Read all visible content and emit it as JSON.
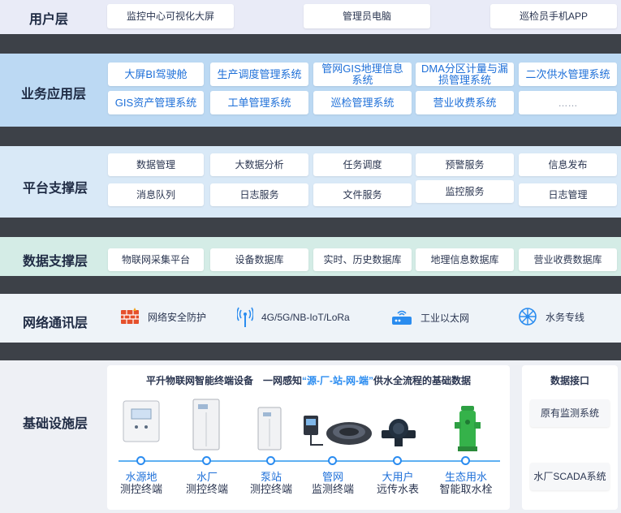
{
  "layers": {
    "user": {
      "title": "用户层",
      "items": [
        "监控中心可视化大屏",
        "管理员电脑",
        "巡检员手机APP"
      ]
    },
    "business": {
      "title": "业务应用层",
      "row1": [
        "大屏BI驾驶舱",
        "生产调度管理系统",
        "管网GIS地理信息系统",
        "DMA分区计量与漏损管理系统",
        "二次供水管理系统"
      ],
      "row2": [
        "GIS资产管理系统",
        "工单管理系统",
        "巡检管理系统",
        "营业收费系统",
        "……"
      ]
    },
    "platform": {
      "title": "平台支撑层",
      "row1": [
        "数据管理",
        "大数据分析",
        "任务调度",
        "预警服务",
        "信息发布"
      ],
      "row2": [
        "消息队列",
        "日志服务",
        "文件服务",
        "监控服务",
        "日志管理"
      ]
    },
    "data": {
      "title": "数据支撑层",
      "items": [
        "物联网采集平台",
        "设备数据库",
        "实时、历史数据库",
        "地理信息数据库",
        "营业收费数据库"
      ]
    },
    "network": {
      "title": "网络通讯层",
      "items": [
        {
          "label": "网络安全防护",
          "icon": "firewall-icon"
        },
        {
          "label": "4G/5G/NB-IoT/LoRa",
          "icon": "antenna-icon"
        },
        {
          "label": "工业以太网",
          "icon": "router-icon"
        },
        {
          "label": "水务专线",
          "icon": "network-node-icon"
        }
      ]
    },
    "infra": {
      "title": "基础设施层",
      "headline_prefix": "平升物联网智能终端设备　一网感知",
      "headline_highlight": "“源-厂-站-网-端”",
      "headline_suffix": "供水全流程的基础数据",
      "devices": [
        {
          "line1": "水源地",
          "line2": "测控终端"
        },
        {
          "line1": "水厂",
          "line2": "测控终端"
        },
        {
          "line1": "泵站",
          "line2": "测控终端"
        },
        {
          "line1": "管网",
          "line2": "监测终端"
        },
        {
          "line1": "大用户",
          "line2": "远传水表"
        },
        {
          "line1": "生态用水",
          "line2": "智能取水栓"
        }
      ],
      "interface": {
        "title": "数据接口",
        "items": [
          "原有监测系统",
          "水厂SCADA系统"
        ]
      }
    }
  },
  "colors": {
    "accent": "#1d6fd8",
    "highlight": "#2b8cf0",
    "separator": "#3d4148"
  }
}
